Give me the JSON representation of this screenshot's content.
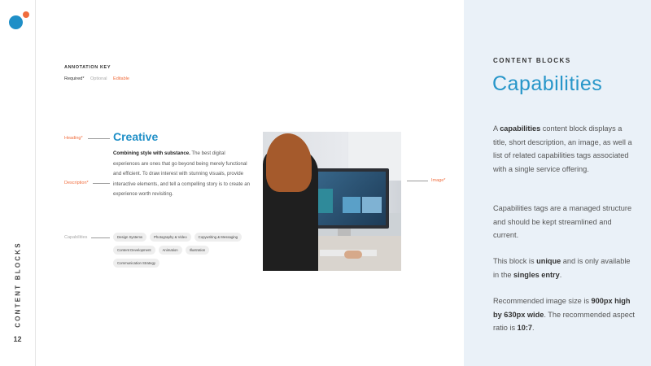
{
  "colors": {
    "brand_blue": "#1f8fc7",
    "accent_orange": "#f06d3d",
    "heading_blue": "#1f8fc7",
    "title_blue": "#2796c9",
    "panel_bg": "#eaf1f8"
  },
  "rail": {
    "title": "CONTENT BLOCKS",
    "page_number": "12"
  },
  "annotation_key": {
    "title": "ANNOTATION KEY",
    "required": "Required*",
    "optional": "Optional",
    "editable": "Editable"
  },
  "annotations": {
    "heading": "Heading*",
    "description": "Description*",
    "capabilities": "Capabilities",
    "image": "Image*"
  },
  "block": {
    "heading": "Creative",
    "desc_bold": "Combining style with substance.",
    "desc_rest": " The best digital experiences are ones that go beyond being merely functional and efficient. To draw interest with stunning visuals, provide interactive elements, and tell a compelling story is to create an experience worth revisiting.",
    "tags": [
      "Design Systems",
      "Photography & Video",
      "Copywriting & Messaging",
      "Content Development",
      "Animation",
      "Illustration",
      "Communication Strategy"
    ]
  },
  "panel": {
    "label": "CONTENT BLOCKS",
    "title": "Capabilities",
    "p1": {
      "a": "A ",
      "b": "capabilities",
      "c": " content block displays a title, short description, an image, as well a list of related capabilities tags associated with a single service offering."
    },
    "p2": "Capabilities tags are a managed structure and should be kept streamlined and current.",
    "p3": {
      "a": "This block is ",
      "b": "unique",
      "c": " and is only available in the ",
      "d": "singles entry",
      "e": "."
    },
    "p4": {
      "a": "Recommended image size is ",
      "b": "900px high by 630px wide",
      "c": ". The recommended aspect ratio is ",
      "d": "10:7",
      "e": "."
    }
  }
}
